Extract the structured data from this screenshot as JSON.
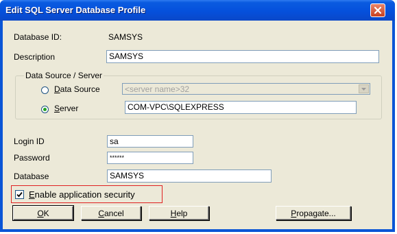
{
  "window": {
    "title": "Edit SQL Server Database Profile"
  },
  "form": {
    "database_id": {
      "label": "Database ID:",
      "value": "SAMSYS"
    },
    "description": {
      "label": "Description",
      "value": "SAMSYS"
    },
    "data_source_group": {
      "title": "Data Source / Server",
      "data_source_option": {
        "label_first": "D",
        "label_rest": "ata Source",
        "selected": false
      },
      "data_source_combo": {
        "value": "<server name>32"
      },
      "server_option": {
        "label_first": "S",
        "label_rest": "erver",
        "selected": true
      },
      "server_value": "COM-VPC\\SQLEXPRESS"
    },
    "login_id": {
      "label": "Login ID",
      "value": "sa"
    },
    "password": {
      "label": "Password",
      "value": "******"
    },
    "database": {
      "label": "Database",
      "value": "SAMSYS"
    },
    "enable_security": {
      "label_first": "E",
      "label_rest": "nable application security",
      "checked": true
    }
  },
  "buttons": {
    "ok": {
      "first": "O",
      "rest": "K"
    },
    "cancel": {
      "first": "C",
      "rest": "ancel"
    },
    "help": {
      "first": "H",
      "rest": "elp"
    },
    "propagate": {
      "first": "P",
      "rest": "ropagate..."
    }
  },
  "colors": {
    "titlebar": "#0550dc",
    "highlight": "#e02020",
    "radio_dot": "#21a121"
  }
}
